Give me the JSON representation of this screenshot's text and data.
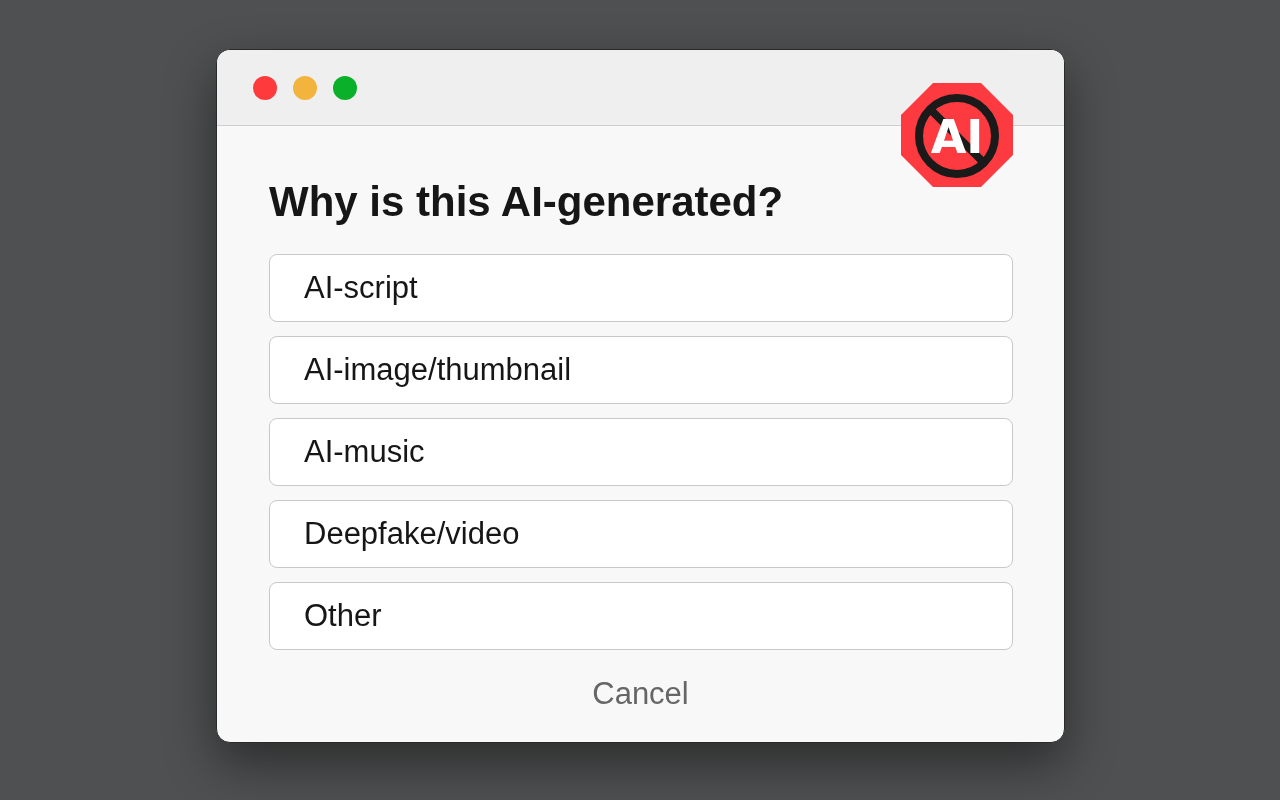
{
  "logo": {
    "text": "AI"
  },
  "title": "Why is this AI-generated?",
  "options": [
    {
      "label": "AI-script"
    },
    {
      "label": "AI-image/thumbnail"
    },
    {
      "label": "AI-music"
    },
    {
      "label": "Deepfake/video"
    },
    {
      "label": "Other"
    }
  ],
  "cancel": "Cancel"
}
